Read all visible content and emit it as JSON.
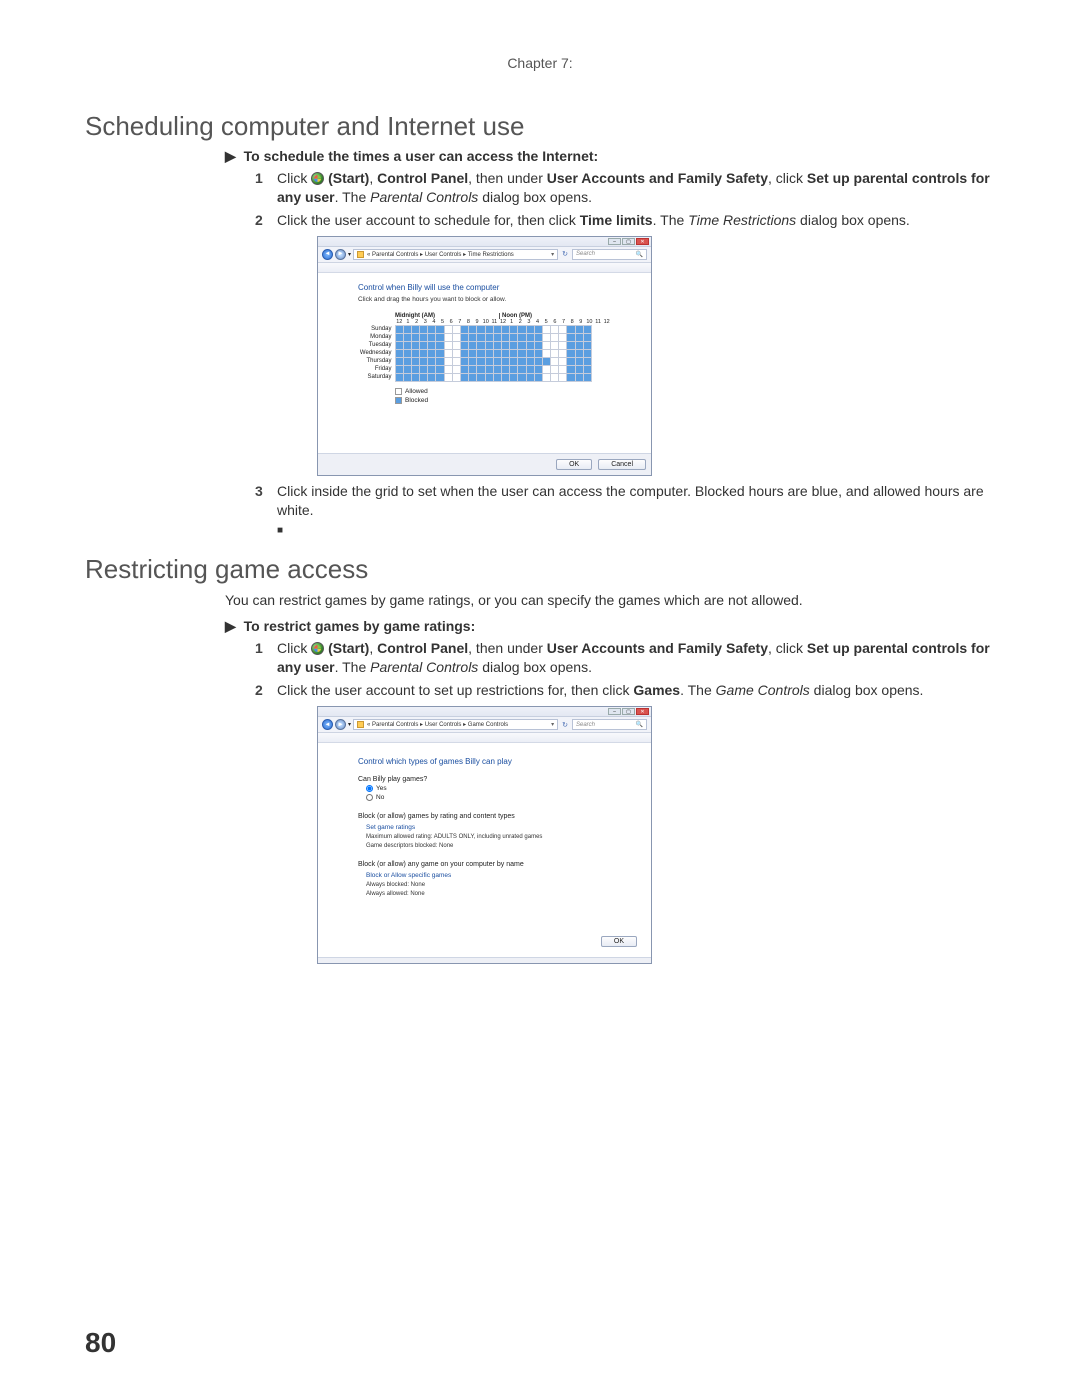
{
  "chapter": "Chapter 7:",
  "page_num": "80",
  "section1": {
    "heading": "Scheduling computer and Internet use",
    "task": "To schedule the times a user can access the Internet:",
    "steps": {
      "s1_a": "Click ",
      "s1_b": " (Start)",
      "s1_c": ", ",
      "s1_d": "Control Panel",
      "s1_e": ", then under ",
      "s1_f": "User Accounts and Family Safety",
      "s1_g": ", click ",
      "s1_h": "Set up parental controls for any user",
      "s1_i": ". The ",
      "s1_j": "Parental Controls",
      "s1_k": " dialog box opens.",
      "s2_a": "Click the user account to schedule for, then click ",
      "s2_b": "Time limits",
      "s2_c": ". The ",
      "s2_d": "Time Restrictions",
      "s2_e": " dialog box opens.",
      "s3": "Click inside the grid to set when the user can access the computer. Blocked hours are blue, and allowed hours are white."
    }
  },
  "section2": {
    "heading": "Restricting game access",
    "intro": "You can restrict games by game ratings, or you can specify the games which are not allowed.",
    "task": "To restrict games by game ratings:",
    "steps": {
      "s1_a": "Click ",
      "s1_b": " (Start)",
      "s1_c": ", ",
      "s1_d": "Control Panel",
      "s1_e": ", then under ",
      "s1_f": "User Accounts and Family Safety",
      "s1_g": ", click ",
      "s1_h": "Set up parental controls for any user",
      "s1_i": ". The ",
      "s1_j": "Parental Controls",
      "s1_k": " dialog box opens.",
      "s2_a": "Click the user account to set up restrictions for, then click ",
      "s2_b": "Games",
      "s2_c": ". The ",
      "s2_d": "Game Controls",
      "s2_e": " dialog box opens."
    }
  },
  "dlg1": {
    "crumbs1": "« Parental Controls",
    "crumbs2": "User Controls",
    "crumbs3": "Time Restrictions",
    "search": "Search",
    "head": "Control when Billy will use the computer",
    "sub": "Click and drag the hours you want to block or allow.",
    "mid": "Midnight (AM)",
    "noon": "Noon (PM)",
    "hours": [
      "12",
      "1",
      "2",
      "3",
      "4",
      "5",
      "6",
      "7",
      "8",
      "9",
      "10",
      "11",
      "12",
      "1",
      "2",
      "3",
      "4",
      "5",
      "6",
      "7",
      "8",
      "9",
      "10",
      "11",
      "12"
    ],
    "days": [
      "Sunday",
      "Monday",
      "Tuesday",
      "Wednesday",
      "Thursday",
      "Friday",
      "Saturday"
    ],
    "legend_allowed": "Allowed",
    "legend_blocked": "Blocked",
    "ok": "OK",
    "cancel": "Cancel",
    "blocked": {
      "0": [
        0,
        1,
        2,
        3,
        4,
        5,
        8,
        9,
        10,
        11,
        12,
        13,
        14,
        15,
        16,
        17,
        21,
        22,
        23
      ],
      "1": [
        0,
        1,
        2,
        3,
        4,
        5,
        8,
        9,
        10,
        11,
        12,
        13,
        14,
        15,
        16,
        17,
        21,
        22,
        23
      ],
      "2": [
        0,
        1,
        2,
        3,
        4,
        5,
        8,
        9,
        10,
        11,
        12,
        13,
        14,
        15,
        16,
        17,
        21,
        22,
        23
      ],
      "3": [
        0,
        1,
        2,
        3,
        4,
        5,
        8,
        9,
        10,
        11,
        12,
        13,
        14,
        15,
        16,
        17,
        21,
        22,
        23
      ],
      "4": [
        0,
        1,
        2,
        3,
        4,
        5,
        8,
        9,
        10,
        11,
        12,
        13,
        14,
        15,
        16,
        17,
        18,
        21,
        22,
        23
      ],
      "5": [
        0,
        1,
        2,
        3,
        4,
        5,
        8,
        9,
        10,
        11,
        12,
        13,
        14,
        15,
        16,
        17,
        21,
        22,
        23
      ],
      "6": [
        0,
        1,
        2,
        3,
        4,
        5,
        8,
        9,
        10,
        11,
        12,
        13,
        14,
        15,
        16,
        17,
        21,
        22,
        23
      ]
    }
  },
  "dlg2": {
    "crumbs1": "« Parental Controls",
    "crumbs2": "User Controls",
    "crumbs3": "Game Controls",
    "search": "Search",
    "head": "Control which types of games Billy can play",
    "q1": "Can Billy play games?",
    "yes": "Yes",
    "no": "No",
    "sect1": "Block (or allow) games by rating and content types",
    "link1": "Set game ratings",
    "small1": "Maximum allowed rating:  ADULTS ONLY, including unrated games",
    "small2": "Game descriptors blocked:  None",
    "sect2": "Block (or allow) any game on your computer by name",
    "link2": "Block or Allow specific games",
    "small3": "Always blocked:  None",
    "small4": "Always allowed:  None",
    "ok": "OK"
  }
}
